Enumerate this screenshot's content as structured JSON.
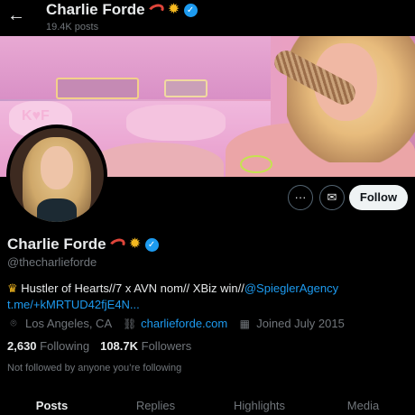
{
  "header": {
    "back_icon": "arrow-left-icon",
    "name": "Charlie Forde",
    "posts_count": "19.4K posts",
    "name_emojis": [
      "shrimp",
      "sun"
    ],
    "verified_icon": "verified-badge-icon"
  },
  "banner": {
    "description_icon": "profile-banner-image"
  },
  "avatar": {
    "icon": "profile-avatar-image"
  },
  "actions": {
    "more_label": "···",
    "mail_label": "✉",
    "follow_label": "Follow"
  },
  "profile": {
    "name": "Charlie Forde",
    "handle": "@thecharlieforde",
    "bio_prefix": "Hustler of Hearts//7 x AVN nom// XBiz win//",
    "bio_mention": "@SpieglerAgency",
    "bio_link": "t.me/+kMRTUD42fjE4N...",
    "location": "Los Angeles, CA",
    "website": "charlieforde.com",
    "joined": "Joined July 2015",
    "following_count": "2,630",
    "following_label": "Following",
    "followers_count": "108.7K",
    "followers_label": "Followers",
    "not_followed": "Not followed by anyone you’re following"
  },
  "tabs": [
    {
      "label": "Posts",
      "active": true
    },
    {
      "label": "Replies",
      "active": false
    },
    {
      "label": "Highlights",
      "active": false
    },
    {
      "label": "Media",
      "active": false
    }
  ],
  "colors": {
    "accent": "#1d9bf0",
    "background": "#000000",
    "text_primary": "#e7e9ea",
    "text_secondary": "#71767b",
    "follow_button_bg": "#eff3f4"
  }
}
